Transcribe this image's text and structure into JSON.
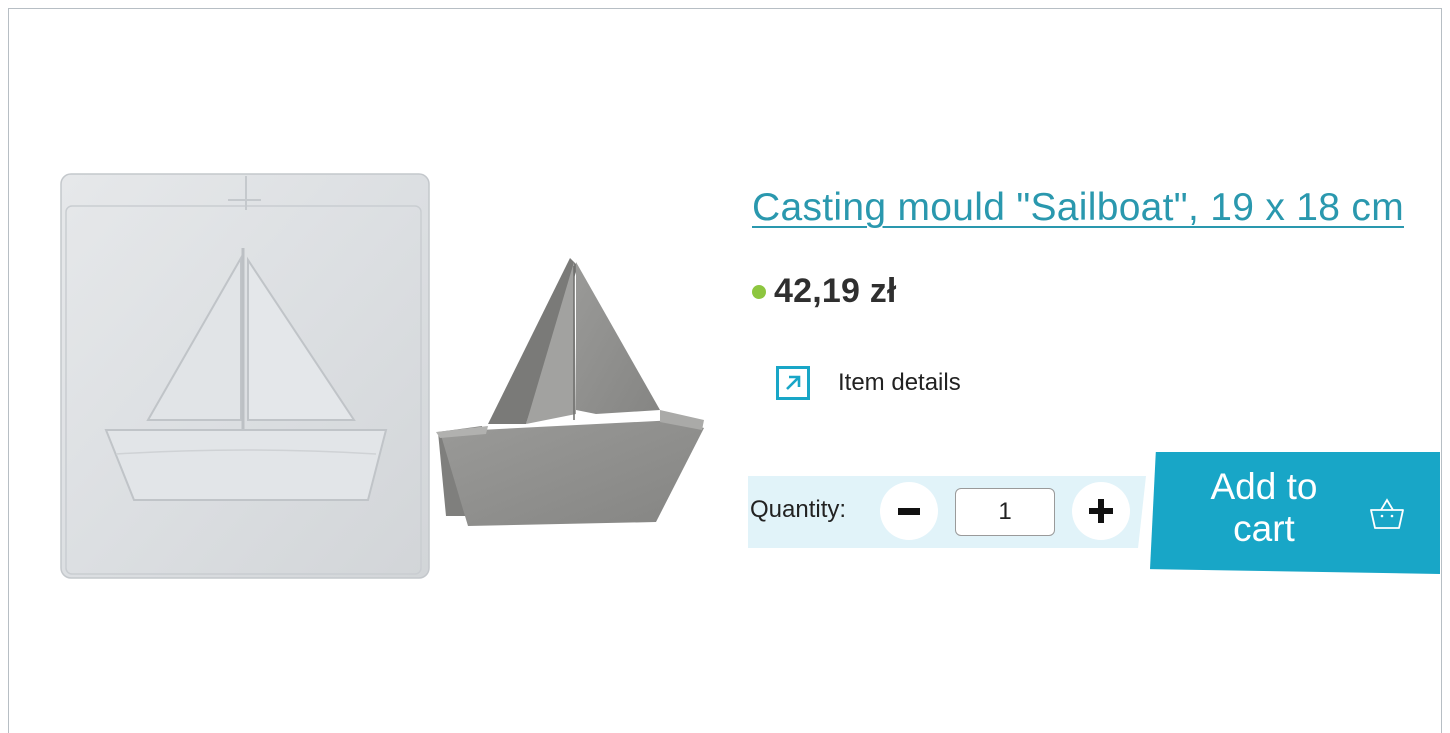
{
  "product": {
    "title": "Casting mould \"Sailboat\", 19 x 18 cm",
    "price": "42,19 zł",
    "stock_color": "#8dc63f",
    "details_link": "Item details",
    "details_icon": "arrow-up-right-icon"
  },
  "cart": {
    "quantity_label": "Quantity:",
    "quantity_value": "1",
    "minus_icon": "minus-icon",
    "plus_icon": "plus-icon",
    "add_label": "Add to cart",
    "basket_icon": "basket-icon"
  },
  "colors": {
    "accent": "#18a6c7",
    "title": "#2a98ae",
    "quantity_bg": "#e1f3f9"
  }
}
